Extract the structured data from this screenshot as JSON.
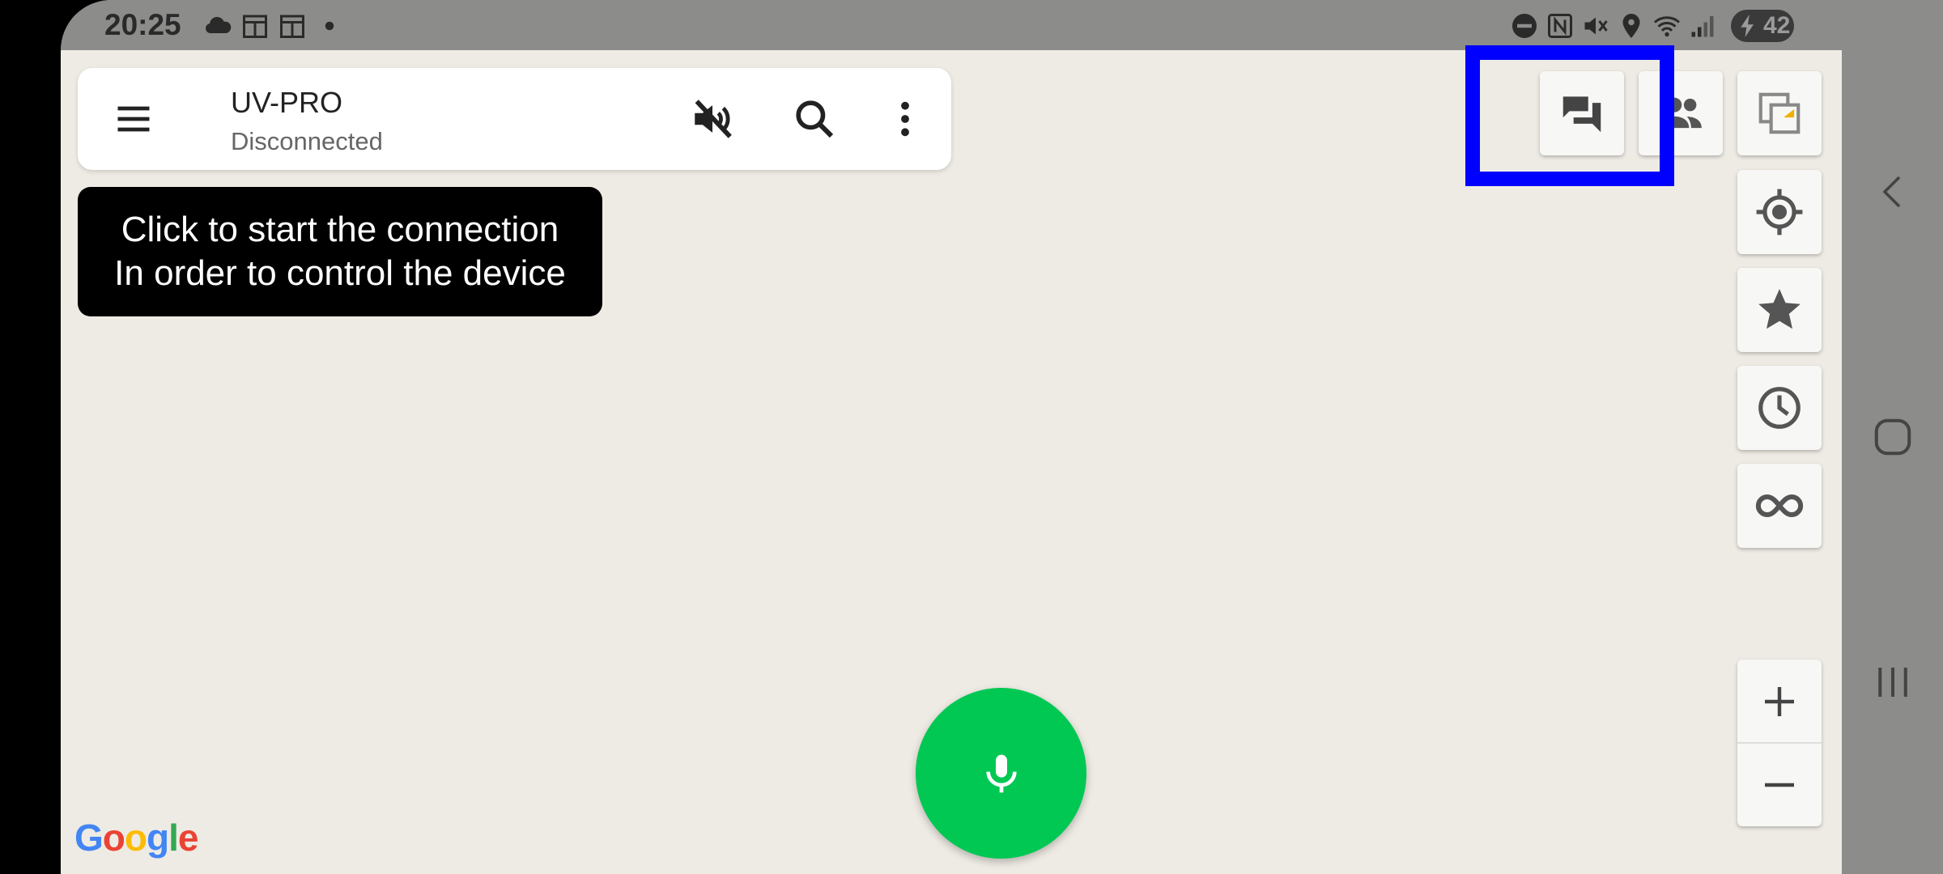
{
  "status_bar": {
    "time": "20:25",
    "icons": [
      "cloud-icon",
      "calendar-icon",
      "calendar-icon",
      "dot-icon",
      "do-not-disturb-icon",
      "nfc-icon",
      "mute-icon",
      "location-icon",
      "wifi-icon",
      "signal-icon"
    ],
    "battery": "42"
  },
  "app": {
    "title": "UV-PRO",
    "subtitle": "Disconnected",
    "menu_icon": "menu-icon",
    "volume_off_icon": "volume-off-icon",
    "search_icon": "search-icon",
    "more_icon": "more-vert-icon"
  },
  "tooltip": {
    "line1": "Click to start the connection",
    "line2": "In order to control the device"
  },
  "map_controls": {
    "top_row": [
      "chat-icon",
      "group-icon",
      "layers-icon"
    ],
    "column": [
      "my-location-icon",
      "star-icon",
      "clock-icon",
      "infinity-icon"
    ],
    "zoom_in": "+",
    "zoom_out": "−"
  },
  "fab": {
    "icon": "microphone-icon",
    "color": "#00c853"
  },
  "map_attribution": "Google",
  "nav": [
    "back-icon",
    "home-icon",
    "recents-icon"
  ],
  "colors": {
    "map_bg": "#eeebe4",
    "highlight": "#0000ff",
    "status_bar": "#8c8c8a"
  }
}
